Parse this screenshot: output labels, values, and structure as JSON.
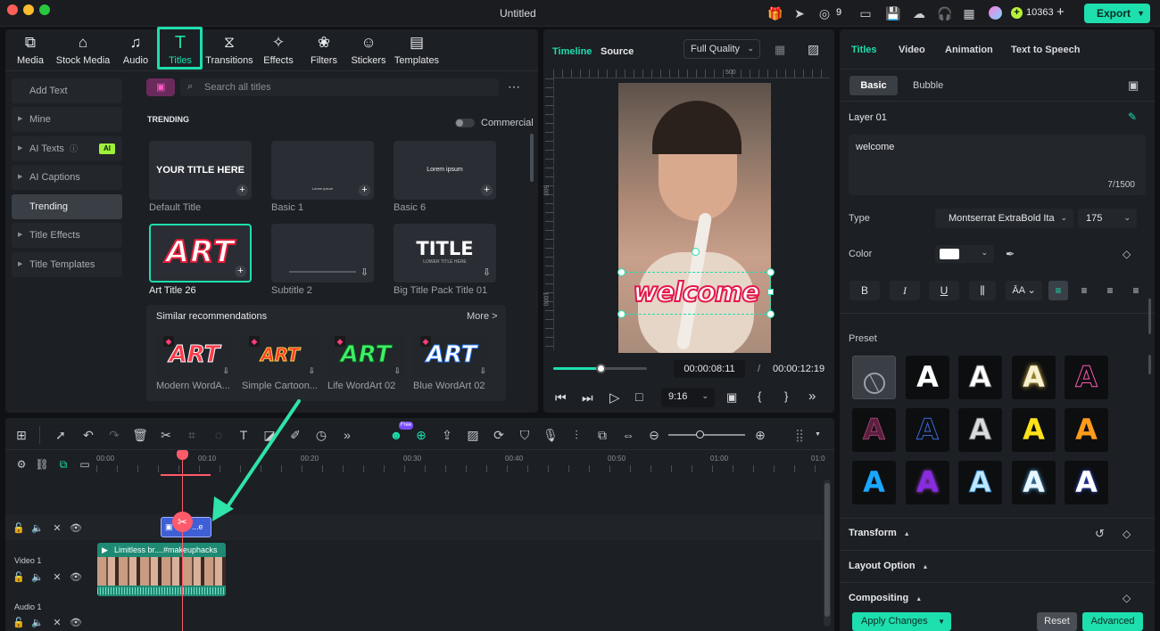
{
  "titlebar": {
    "title": "Untitled",
    "notif_count": "9",
    "credits": "10363",
    "export_label": "Export"
  },
  "media_tabs": [
    {
      "label": "Media",
      "icon": "media-icon"
    },
    {
      "label": "Stock Media",
      "icon": "stock-media-icon"
    },
    {
      "label": "Audio",
      "icon": "audio-icon"
    },
    {
      "label": "Titles",
      "icon": "titles-icon",
      "active": true
    },
    {
      "label": "Transitions",
      "icon": "transitions-icon"
    },
    {
      "label": "Effects",
      "icon": "effects-icon"
    },
    {
      "label": "Filters",
      "icon": "filters-icon"
    },
    {
      "label": "Stickers",
      "icon": "stickers-icon"
    },
    {
      "label": "Templates",
      "icon": "templates-icon"
    }
  ],
  "sidebar": {
    "add_text": "Add Text",
    "mine": "Mine",
    "ai_texts": "AI Texts",
    "ai_badge": "AI",
    "ai_captions": "AI Captions",
    "trending": "Trending",
    "title_effects": "Title Effects",
    "title_templates": "Title Templates"
  },
  "browser": {
    "search_placeholder": "Search all titles",
    "section": "TRENDING",
    "commercial": "Commercial",
    "cards": [
      {
        "name": "Default Title",
        "thumb_text": "YOUR TITLE HERE"
      },
      {
        "name": "Basic 1",
        "thumb_text": "Lorem ipsum"
      },
      {
        "name": "Basic 6",
        "thumb_text": "Lorem ipsum"
      },
      {
        "name": "Art Title 26",
        "thumb_text": "ART"
      },
      {
        "name": "Subtitle 2",
        "thumb_text": ""
      },
      {
        "name": "Big Title Pack Title 01",
        "thumb_text": "TITLE",
        "thumb_sub": "LOWER TITLE HERE"
      }
    ],
    "similar_label": "Similar recommendations",
    "more_label": "More >",
    "recommendations": [
      {
        "name": "Modern WordA...",
        "thumb_text": "ART"
      },
      {
        "name": "Simple Cartoon...",
        "thumb_text": "ART"
      },
      {
        "name": "Life WordArt 02",
        "thumb_text": "ART"
      },
      {
        "name": "Blue WordArt 02",
        "thumb_text": "ART"
      }
    ]
  },
  "preview": {
    "tab_timeline": "Timeline",
    "tab_source": "Source",
    "quality": "Full Quality",
    "ruler_500": "500",
    "ruler_left_500": "500",
    "ruler_left_1000": "1000",
    "overlay_text": "welcome",
    "current_time": "00:00:08:11",
    "separator": "/",
    "total_time": "00:00:12:19",
    "aspect": "9:16",
    "progress": 0.5
  },
  "timeline": {
    "ruler": [
      "00:00",
      "00:10",
      "00:20",
      "00:30",
      "00:40",
      "00:50",
      "01:00",
      "01:0"
    ],
    "free_badge": "Free",
    "title_clip": "...e",
    "video_clip": "Limitless br....#makeuphacks",
    "video_track": "Video 1",
    "audio_track": "Audio 1"
  },
  "right_panel": {
    "tabs": [
      "Titles",
      "Video",
      "Animation",
      "Text to Speech"
    ],
    "subtabs": [
      "Basic",
      "Bubble"
    ],
    "layer": "Layer 01",
    "text_value": "welcome",
    "char_count": "7/1500",
    "type_label": "Type",
    "font": "Montserrat ExtraBold Ita",
    "font_size": "175",
    "color_label": "Color",
    "preset_label": "Preset",
    "transform": "Transform",
    "layout_option": "Layout Option",
    "compositing": "Compositing",
    "apply": "Apply Changes",
    "reset": "Reset",
    "advanced": "Advanced"
  },
  "colors": {
    "accent": "#1ddfae",
    "clip_title": "#3f5fd6",
    "clip_video": "#1e8a74",
    "playhead": "#ff5a6a"
  }
}
